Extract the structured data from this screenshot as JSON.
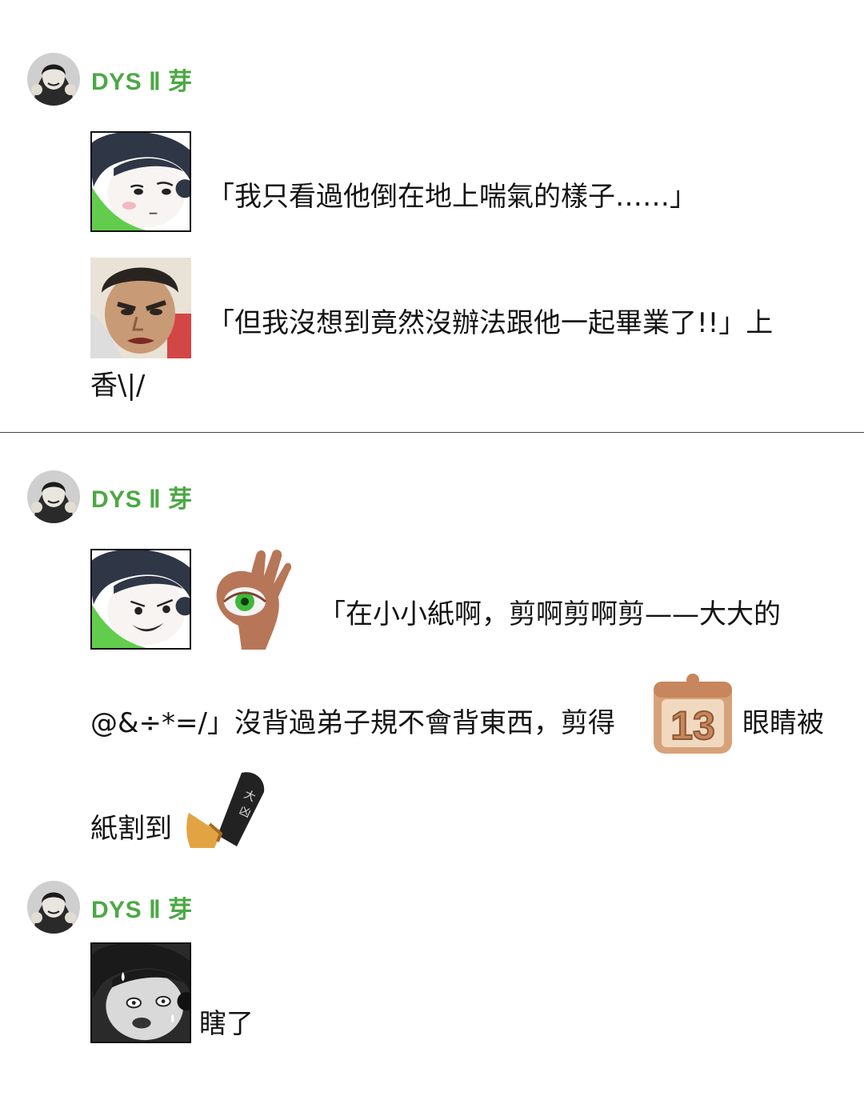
{
  "messages": [
    {
      "username": "DYS Ⅱ 芽",
      "line1": "「我只看過他倒在地上喘氣的樣子……」",
      "line2": "「但我沒想到竟然沒辦法跟他一起畢業了!!」上",
      "line3": "香\\|/"
    },
    {
      "username": "DYS Ⅱ 芽",
      "line1": "「在小小紙啊，剪啊剪啊剪——大大的",
      "line2a": "@&÷*=/」沒背過弟子規不會背東西，剪得",
      "line2b": "眼睛被",
      "line3": "紙割到",
      "calendar_number": "13"
    },
    {
      "username": "DYS Ⅱ 芽",
      "text": "瞎了"
    }
  ],
  "colors": {
    "username": "#4ca844",
    "emote_green": "#62cc4c",
    "calendar": "#d6a27a"
  },
  "icons": [
    "user-avatar",
    "pale-face-emote",
    "angry-man-emote",
    "smirk-face-emote",
    "ok-hand-eye-emote",
    "calendar-emote",
    "knife-emote",
    "shocked-face-emote"
  ]
}
